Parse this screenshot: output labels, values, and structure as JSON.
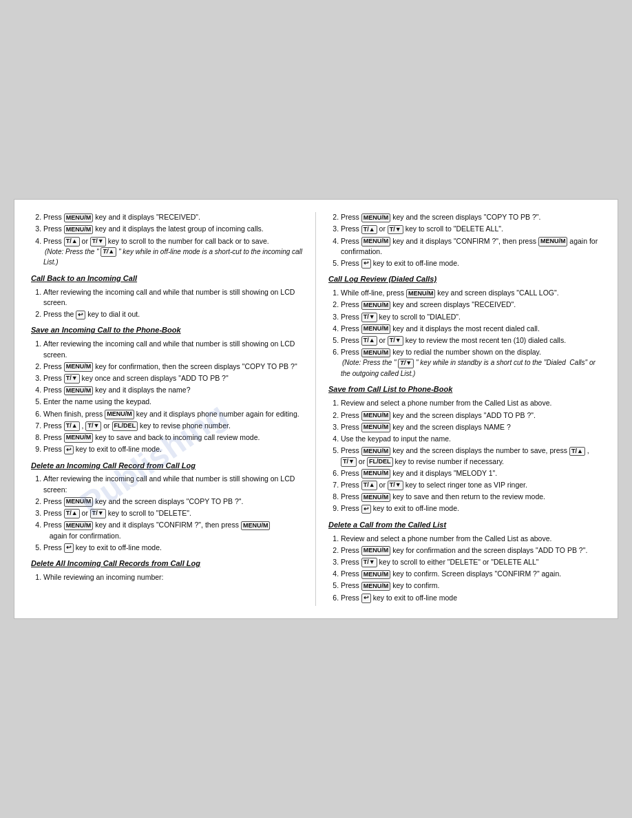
{
  "left_col": {
    "items_before_sections": [
      {
        "num": "2.",
        "text": "Press ",
        "key": "MENU/M",
        "rest": " key and it displays \"RECEIVED\"."
      },
      {
        "num": "3.",
        "text": "Press ",
        "key": "MENU/M",
        "rest": " key and it displays the latest group of incoming calls."
      },
      {
        "num": "4.",
        "text": "Press ",
        "key": "T/▲",
        "rest": " or ",
        "key2": "T/▼",
        "rest2": " key to scroll to the number for call back or to save."
      }
    ],
    "note1": "(Note: Press the \" T/▲ \" key while in off-line mode is a short-cut to the incoming call List.)",
    "section1_title": "Call Back to an Incoming Call",
    "section1_items": [
      "After reviewing the incoming call and while that number is still showing on LCD screen.",
      "Press the  ↩  key to dial it out."
    ],
    "section2_title": "Save an Incoming Call to the Phone-Book",
    "section2_items": [
      "After reviewing the incoming call and while that number is still showing on LCD screen.",
      "Press MENU/M key for confirmation, then the screen displays \"COPY TO PB ?\"",
      "Press T/▼ key once and screen displays \"ADD TO PB ?\"",
      "Press MENU/M key and it displays the name?",
      "Enter the name using the keypad.",
      "When finish, press MENU/M key and it displays phone number again for editing.",
      "Press T/▲ , T/▼ or FL/DEL key to revise phone number.",
      "Press MENU/M key to save and back to incoming call review mode.",
      "Press ↩ key to exit to off-line mode."
    ],
    "section3_title": "Delete an Incoming Call Record from Call Log",
    "section3_items": [
      "After reviewing the incoming call and while that number is still showing on LCD screen:",
      "Press MENU/M key and the screen displays \"COPY TO PB ?\".",
      "Press T/▲ or T/▼ key to scroll to \"DELETE\".",
      "Press MENU/M key and it displays \"CONFIRM ?\", then press MENU/M again for confirmation.",
      "Press ↩ key to exit to off-line mode."
    ],
    "section4_title": "Delete All Incoming Call Records from Call Log",
    "section4_items": [
      "While reviewing an incoming number:"
    ]
  },
  "right_col": {
    "items_at_top": [
      "Press MENU/M key and the screen displays \"COPY TO PB ?\".",
      "Press T/▲ or T/▼ key to scroll to \"DELETE ALL\".",
      "Press MENU/M key and it displays \"CONFIRM ?\", then press MENU/M again for confirmation.",
      "Press ↩ key to exit to off-line mode."
    ],
    "section1_title": "Call Log Review (Dialed Calls)",
    "section1_items": [
      "While off-line, press MENU/M key and screen displays \"CALL LOG\".",
      "Press MENU/M key and screen displays \"RECEIVED\".",
      "Press T/▼ key to scroll to \"DIALED\".",
      "Press MENU/M key and it displays the most recent dialed call.",
      "Press T/▲ or T/▼ key to review the most recent ten (10) dialed calls.",
      "Press MENU/M key to redial the number shown on the display."
    ],
    "note2": "(Note:  Press the \" T/▼ \" key while in standby is a short cut to the \"Dialed  Calls\" or the outgoing called List.)",
    "section2_title": "Save from Call List to Phone-Book",
    "section2_items": [
      "Review and select a phone number from the Called List as above.",
      "Press MENU/M key and the screen displays \"ADD TO PB ?\".",
      "Press MENU/M key and the screen displays NAME ?",
      "Use the keypad to input the name.",
      "Press MENU/M key and the screen displays the number to save, press T/▲ , T/▼ or FL/DEL key to revise number if necessary.",
      "Press MENU/M key and it displays \"MELODY 1\".",
      "Press T/▲ or T/▼ key to select ringer tone as VIP ringer.",
      "Press MENU/M key to save and then return to the review mode.",
      "Press ↩ key to exit to off-line mode."
    ],
    "section3_title": "Delete a Call from the Called List",
    "section3_items": [
      "Review and select a phone number from the Called List as above.",
      "Press MENU/M key for confirmation and the screen displays \"ADD TO PB ?\".",
      "Press T/▼ key to scroll to either \"DELETE\" or \"DELETE ALL\"",
      "Press MENU/M key to confirm.  Screen displays \"CONFIRM ?\" again.",
      "Press MENU/M key to confirm.",
      "Press ↩ key to exit to off-line mode"
    ]
  },
  "watermark": "Publishing"
}
